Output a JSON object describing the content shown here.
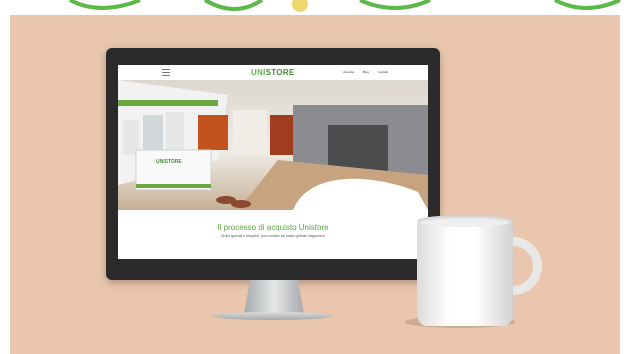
{
  "site": {
    "logo_prefix": "UNI",
    "logo_suffix": "STORE",
    "nav_links": [
      "Azienda",
      "Blog",
      "Contatti"
    ],
    "hero_title": "Il processo di acquisto Unistore",
    "hero_subtitle": "Ordini speciali e frequenti, puoi contare sul nostro grande magazzino!",
    "store_sign": "UNISTORE"
  },
  "colors": {
    "background": "#e9c6ad",
    "brand_green": "#5bb947"
  }
}
